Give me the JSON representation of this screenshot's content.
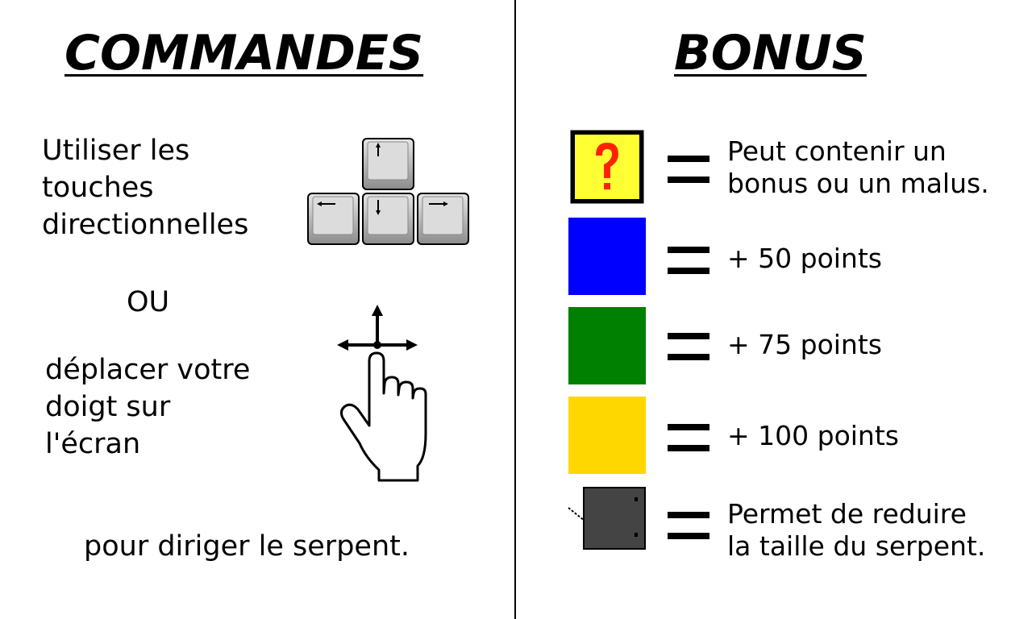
{
  "commands": {
    "title": "COMMANDES",
    "keys_text": "Utiliser les\ntouches\ndirectionnelles",
    "or_text": "OU",
    "touch_text": "déplacer votre\ndoigt sur\nl'écran",
    "footer_text": "pour diriger le serpent.",
    "keys": [
      {
        "icon": "arrow-up-key-icon"
      },
      {
        "icon": "arrow-left-key-icon"
      },
      {
        "icon": "arrow-down-key-icon"
      },
      {
        "icon": "arrow-right-key-icon"
      }
    ],
    "touch_icon": "swipe-hand-icon"
  },
  "bonus": {
    "title": "BONUS",
    "items": [
      {
        "icon": "mystery-box-icon",
        "colors": {
          "fill": "#ffff33",
          "mark": "#ff2200"
        },
        "text": "Peut contenir un\nbonus ou un malus."
      },
      {
        "icon": "blue-square-icon",
        "color": "#0000ff",
        "text": "+ 50 points"
      },
      {
        "icon": "green-square-icon",
        "color": "#008000",
        "text": "+ 75 points"
      },
      {
        "icon": "yellow-square-icon",
        "color": "#ffd700",
        "text": "+ 100 points"
      },
      {
        "icon": "scissors-block-icon",
        "color": "#444444",
        "text": "Permet de reduire\nla taille du serpent."
      }
    ]
  }
}
